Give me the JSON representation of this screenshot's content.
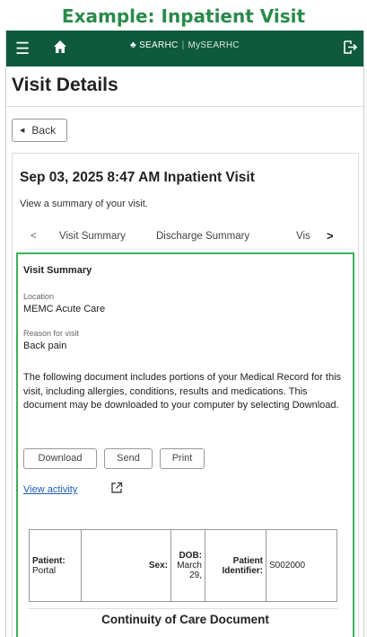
{
  "caption": "Example: Inpatient Visit",
  "topbar": {
    "brand": "SEARHC",
    "portal": "MySEARHC"
  },
  "page_title": "Visit Details",
  "back_label": "Back",
  "visit": {
    "title": "Sep 03, 2025 8:47 AM Inpatient Visit",
    "subtitle": "View a summary of your visit."
  },
  "tabs": [
    "Visit Summary",
    "Discharge Summary",
    "Vis"
  ],
  "summary": {
    "heading": "Visit Summary",
    "location_label": "Location",
    "location_value": "MEMC Acute Care",
    "reason_label": "Reason for visit",
    "reason_value": "Back pain",
    "description": "The following document includes portions of your Medical Record for this visit, including allergies, conditions, results and medications. This document may be downloaded to your computer by selecting Download.",
    "buttons": {
      "download": "Download",
      "send": "Send",
      "print": "Print"
    },
    "view_activity": "View activity"
  },
  "patient_table": {
    "patient_label": "Patient:",
    "patient_value": "Portal",
    "sex_label": "Sex:",
    "dob_label": "DOB:",
    "dob_value_1": "March",
    "dob_value_2": "29,",
    "identifier_label_1": "Patient",
    "identifier_label_2": "Identifier:",
    "identifier_value": "S002000"
  },
  "document_title": "Continuity of Care Document",
  "colors": {
    "header_bg": "#0f5a3e",
    "caption": "#2a8a4a",
    "summary_border": "#3cb25a",
    "link": "#1a5fb4"
  },
  "icons": [
    "menu-icon",
    "home-icon",
    "logo-icon",
    "logout-icon",
    "chevron-left-icon",
    "chevron-right-icon",
    "external-link-icon"
  ]
}
